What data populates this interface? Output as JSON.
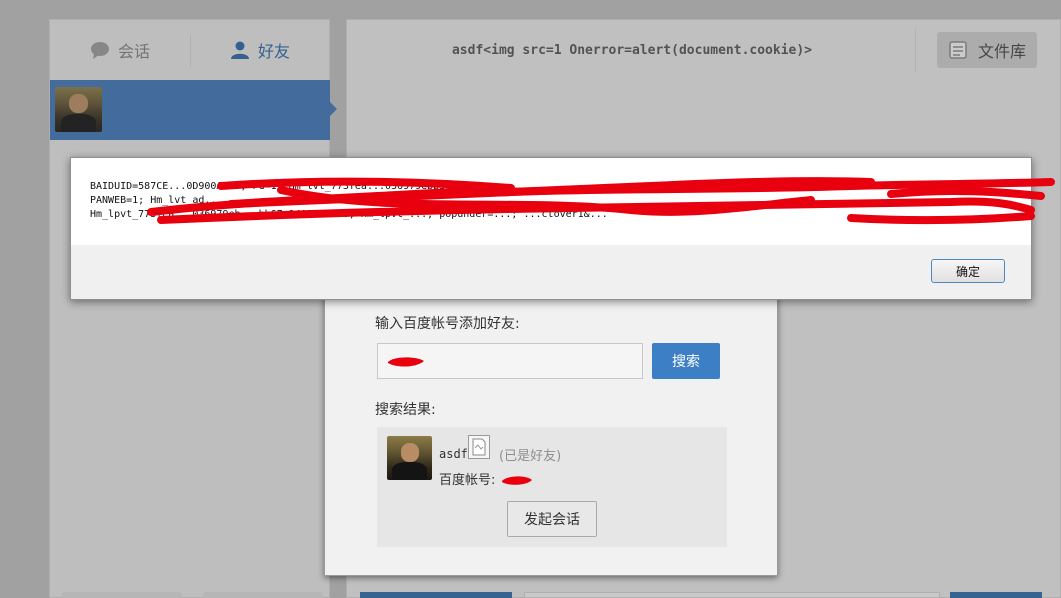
{
  "sidebar": {
    "tabs": [
      {
        "label": "会话",
        "icon": "chat-bubble-icon",
        "active": false
      },
      {
        "label": "好友",
        "icon": "user-icon",
        "active": true
      }
    ],
    "selected_contact": {
      "avatar": "user-avatar"
    }
  },
  "chat_header": {
    "title": "asdf<img src=1 Onerror=alert(document.cookie)>",
    "file_library_label": "文件库",
    "file_library_icon": "document-icon"
  },
  "add_friend_dialog": {
    "prompt": "输入百度帐号添加好友:",
    "search_button_label": "搜索",
    "results_label": "搜索结果:",
    "result": {
      "name": "asdf",
      "status": "(已是好友)",
      "account_label": "百度帐号:",
      "start_chat_label": "发起会话"
    }
  },
  "alert": {
    "message": "BAIDUID=587CE...0D900A...; PG=1; Hm_lvt_773fea...036979ebb5f8...\nPANWEB=1; Hm_lvt_ad...\nHm_lpvt_773fea...036979eb...bb67=1403850088; Hm_lpvt_...; popunder=...; ...ctover1&...",
    "ok_label": "确定"
  },
  "colors": {
    "accent": "#3c7fc5",
    "selected_row": "#3f74b4",
    "redaction": "#e8000f"
  }
}
